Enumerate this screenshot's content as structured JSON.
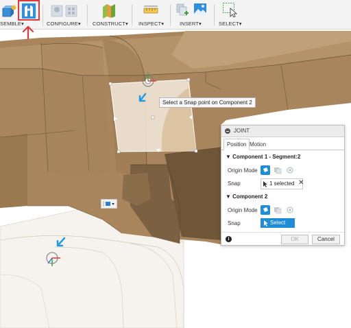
{
  "toolbar": {
    "groups": [
      {
        "label": "SEMBLE",
        "arrow": "▾"
      },
      {
        "label": "CONFIGURE",
        "arrow": "▾"
      },
      {
        "label": "CONSTRUCT",
        "arrow": "▾"
      },
      {
        "label": "INSPECT",
        "arrow": "▾"
      },
      {
        "label": "INSERT",
        "arrow": "▾"
      },
      {
        "label": "SELECT",
        "arrow": "▾"
      }
    ],
    "icons": {
      "new_component": "new-component-icon",
      "joint": "joint-icon",
      "configure": "configure-icon",
      "construct": "construct-plane-icon",
      "inspect": "measure-icon",
      "insert_derive": "insert-derive-icon",
      "insert_image": "insert-image-icon",
      "select": "select-cursor-icon"
    },
    "highlight_color": "#e0383b"
  },
  "viewport": {
    "tooltip": "Select a Snap point on Component 2",
    "accent": "#1f9be6",
    "model_color": "#a8855c"
  },
  "joint_panel": {
    "title": "JOINT",
    "tabs": [
      "Position",
      "Motion"
    ],
    "component1": {
      "header": "Component 1 - Segment:2",
      "origin_mode_label": "Origin Mode",
      "snap_label": "Snap",
      "snap_value": "1 selected",
      "clear": "✕"
    },
    "component2": {
      "header": "Component 2",
      "origin_mode_label": "Origin Mode",
      "snap_label": "Snap",
      "snap_value": "Select"
    },
    "ok": "OK",
    "cancel": "Cancel",
    "info": "i"
  }
}
